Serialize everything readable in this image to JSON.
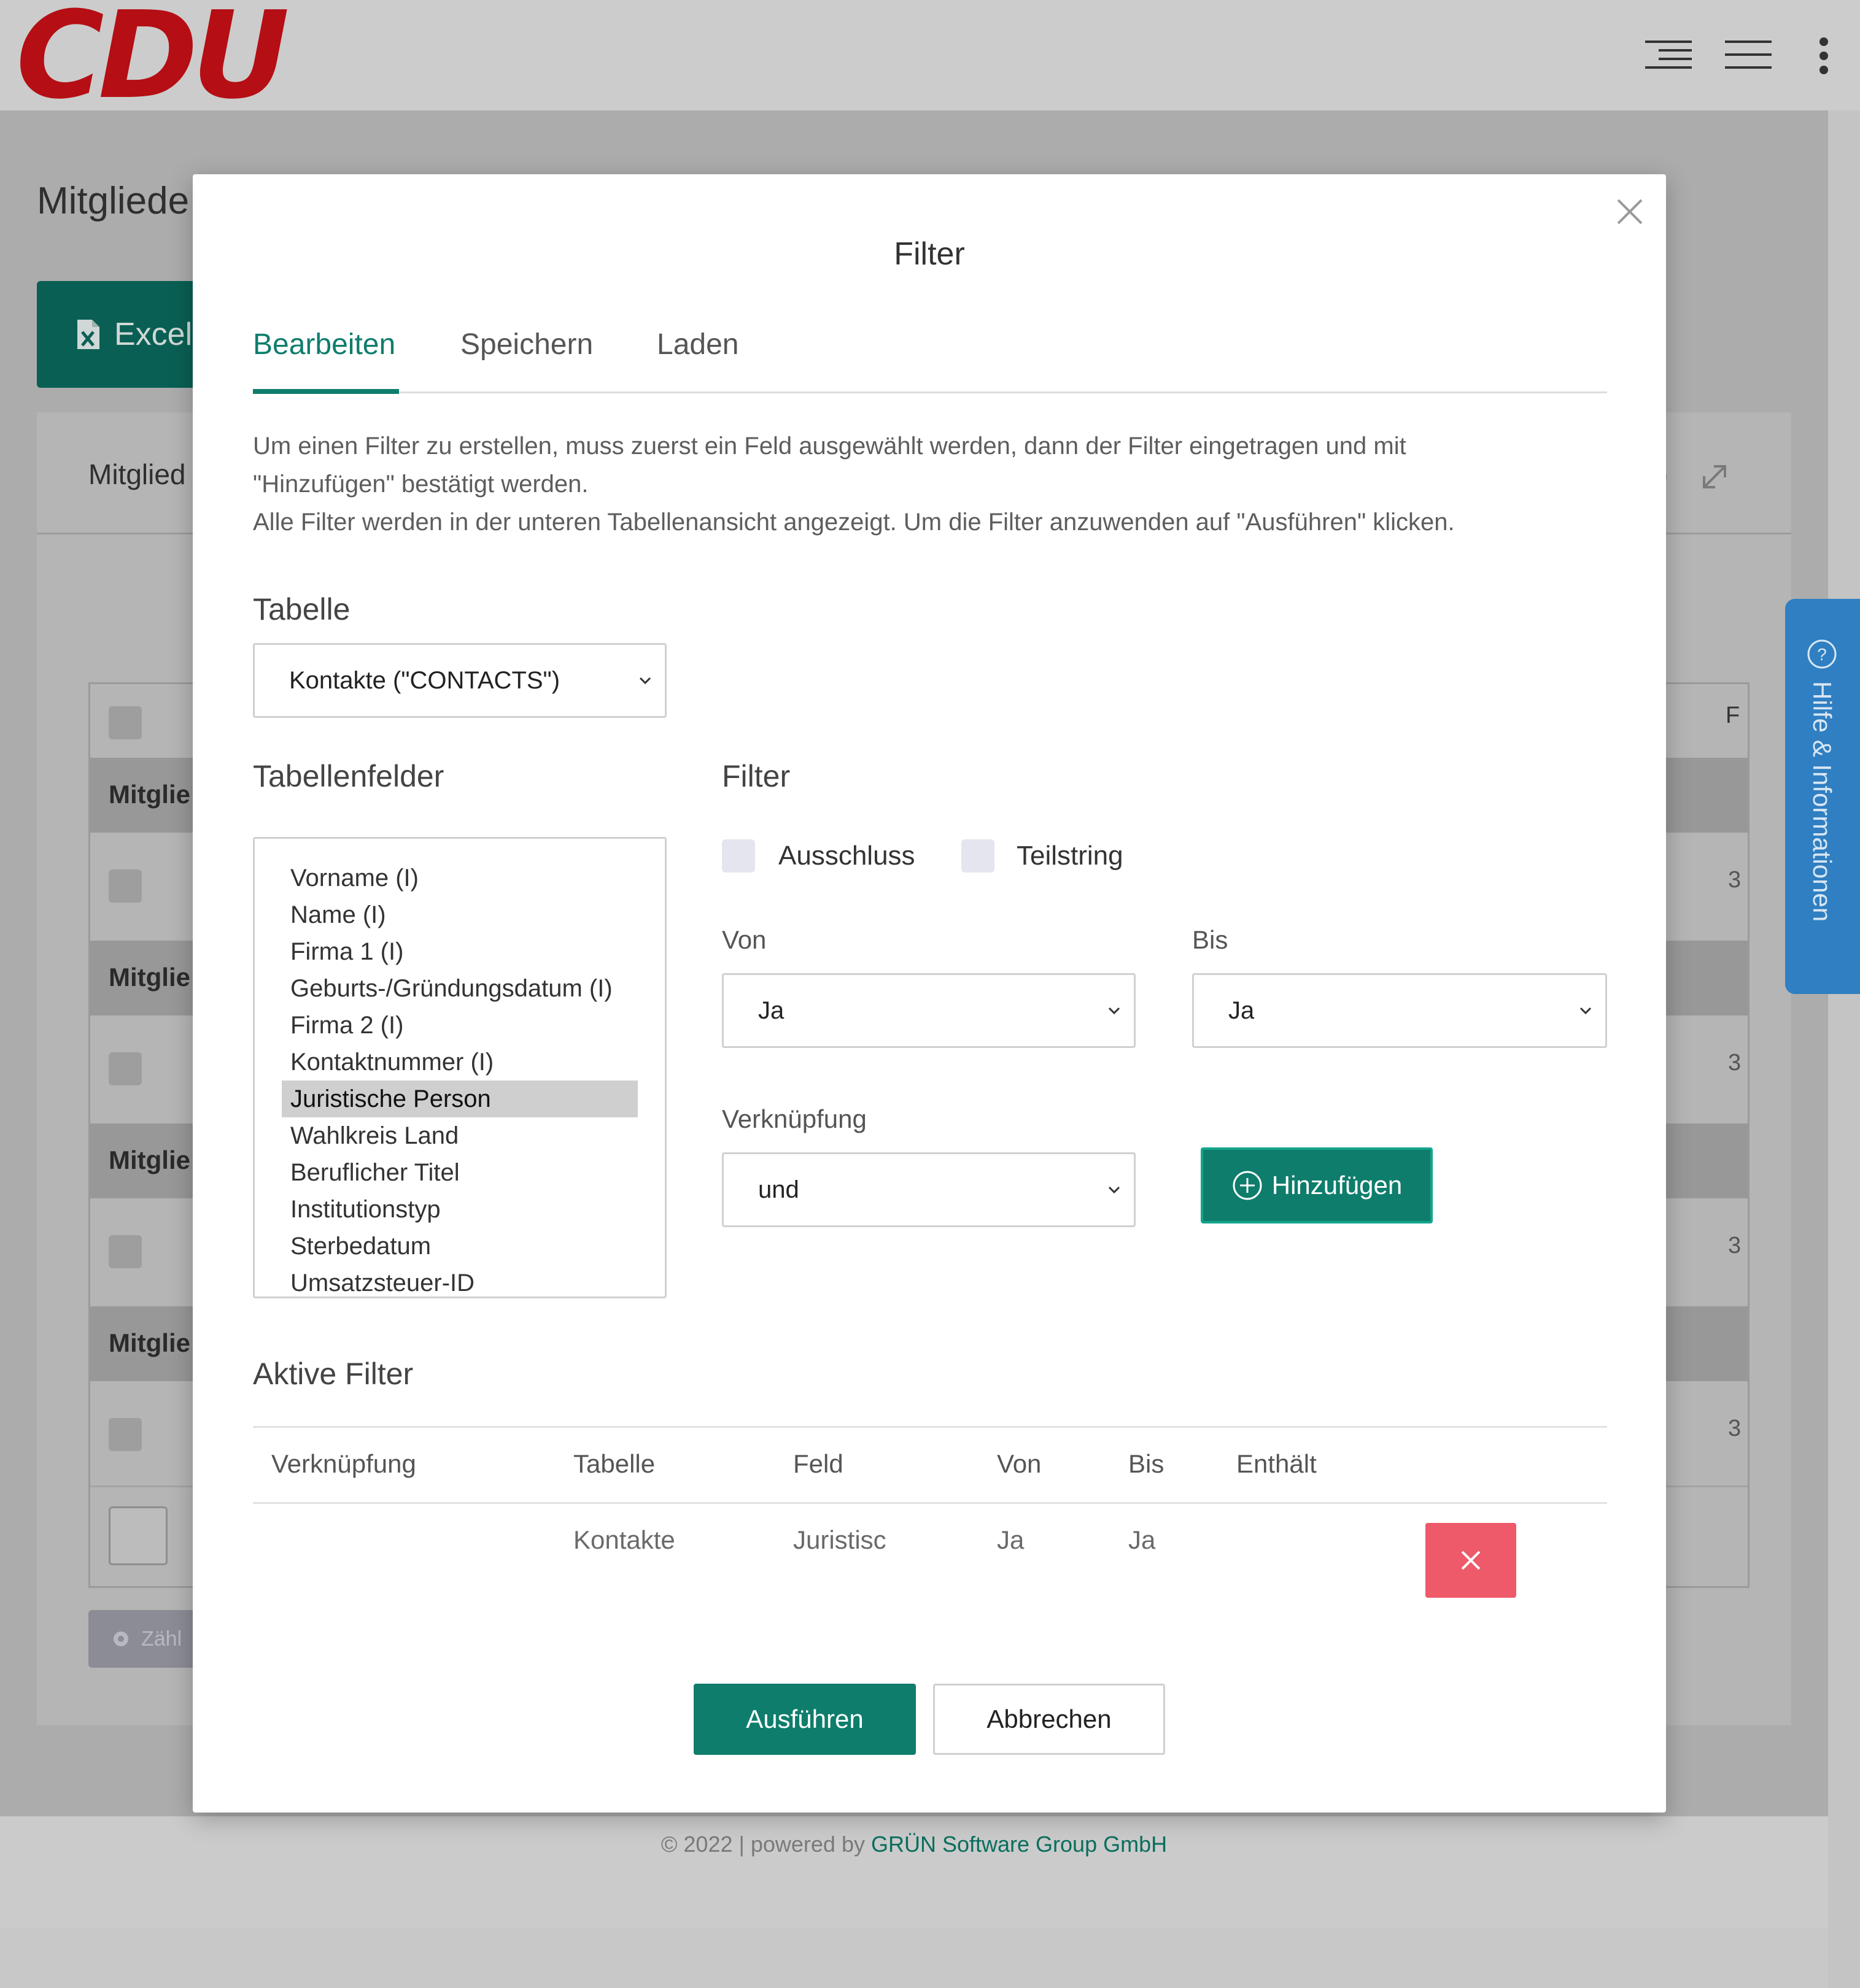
{
  "header": {
    "logo_text": "CDU",
    "icons": [
      "menu-indent-icon",
      "menu-icon",
      "kebab-icon"
    ]
  },
  "background": {
    "page_title": "Mitgliede",
    "excel_button": "Excel",
    "card_title": "Mitglied",
    "row_label": "Mitglie",
    "right_col_header": "F",
    "right_col_value": "3",
    "zahl_button": "Zähl",
    "help_tab": "Hilfe & Informationen"
  },
  "modal": {
    "title": "Filter",
    "tabs": [
      {
        "label": "Bearbeiten",
        "active": true
      },
      {
        "label": "Speichern",
        "active": false
      },
      {
        "label": "Laden",
        "active": false
      }
    ],
    "description": [
      "Um einen Filter zu erstellen, muss zuerst ein Feld ausgewählt werden, dann der Filter eingetragen und mit",
      "\"Hinzufügen\" bestätigt werden.",
      "Alle Filter werden in der unteren Tabellenansicht angezeigt. Um die Filter anzuwenden auf \"Ausführen\" klicken."
    ],
    "table_section": {
      "label": "Tabelle",
      "selected": "Kontakte (\"CONTACTS\")"
    },
    "fields_section": {
      "label": "Tabellenfelder",
      "items": [
        "Vorname (I)",
        "Name (I)",
        "Firma 1 (I)",
        "Geburts-/Gründungsdatum (I)",
        "Firma 2 (I)",
        "Kontaktnummer (I)",
        "Juristische Person",
        "Wahlkreis Land",
        "Beruflicher Titel",
        "Institutionstyp",
        "Sterbedatum",
        "Umsatzsteuer-ID"
      ],
      "selected_index": 6
    },
    "filter_section": {
      "label": "Filter",
      "checkbox_exclude": "Ausschluss",
      "checkbox_substring": "Teilstring",
      "from_label": "Von",
      "from_value": "Ja",
      "to_label": "Bis",
      "to_value": "Ja",
      "link_label": "Verknüpfung",
      "link_value": "und",
      "add_button": "Hinzufügen"
    },
    "active_filters": {
      "label": "Aktive Filter",
      "columns": [
        "Verknüpfung",
        "Tabelle",
        "Feld",
        "Von",
        "Bis",
        "Enthält"
      ],
      "rows": [
        {
          "link": "",
          "table": "Kontakte",
          "field": "Juristisc",
          "from": "Ja",
          "to": "Ja",
          "contains": ""
        }
      ]
    },
    "run_button": "Ausführen",
    "cancel_button": "Abbrechen"
  },
  "footer": {
    "prefix": "© 2022 | powered by ",
    "brand": "GRÜN Software Group GmbH"
  },
  "colors": {
    "brand_red": "#b50e14",
    "accent_green": "#0e7d6c",
    "delete_red": "#ee5a6a",
    "help_blue": "#2f7fc2"
  }
}
